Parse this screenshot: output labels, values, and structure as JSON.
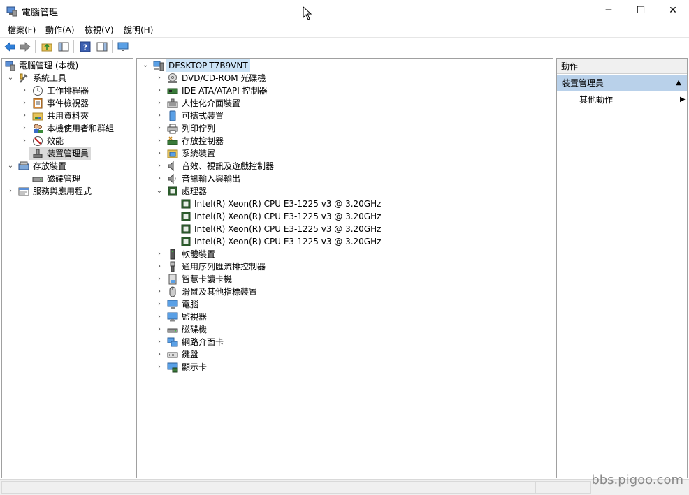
{
  "window": {
    "title": "電腦管理",
    "minimize": "─",
    "maximize": "☐",
    "close": "✕"
  },
  "menu": [
    "檔案(F)",
    "動作(A)",
    "檢視(V)",
    "說明(H)"
  ],
  "left_tree": {
    "root": "電腦管理 (本機)",
    "system_tools": "系統工具",
    "task_scheduler": "工作排程器",
    "event_viewer": "事件檢視器",
    "shared_folders": "共用資料夾",
    "local_users": "本機使用者和群組",
    "performance": "效能",
    "device_manager": "裝置管理員",
    "storage": "存放裝置",
    "disk_management": "磁碟管理",
    "services": "服務與應用程式"
  },
  "device_tree": {
    "computer": "DESKTOP-T7B9VNT",
    "categories": [
      "DVD/CD-ROM 光碟機",
      "IDE ATA/ATAPI 控制器",
      "人性化介面裝置",
      "可攜式裝置",
      "列印佇列",
      "存放控制器",
      "系統裝置",
      "音效、視訊及遊戲控制器",
      "音訊輸入與輸出",
      "處理器"
    ],
    "processors": [
      "Intel(R) Xeon(R) CPU E3-1225 v3 @ 3.20GHz",
      "Intel(R) Xeon(R) CPU E3-1225 v3 @ 3.20GHz",
      "Intel(R) Xeon(R) CPU E3-1225 v3 @ 3.20GHz",
      "Intel(R) Xeon(R) CPU E3-1225 v3 @ 3.20GHz"
    ],
    "categories_after": [
      "軟體裝置",
      "通用序列匯流排控制器",
      "智慧卡讀卡機",
      "滑鼠及其他指標裝置",
      "電腦",
      "監視器",
      "磁碟機",
      "網路介面卡",
      "鍵盤",
      "顯示卡"
    ]
  },
  "actions": {
    "header": "動作",
    "section": "裝置管理員",
    "more": "其他動作"
  },
  "watermark": "bbs.pigoo.com"
}
